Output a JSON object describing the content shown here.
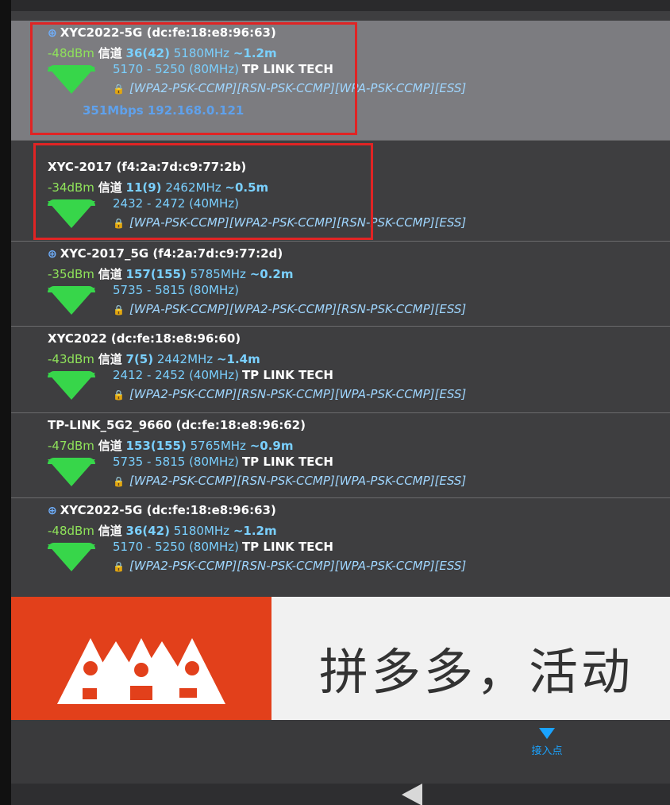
{
  "networks": [
    {
      "globe": "⊕",
      "ssid": "XYC2022-5G (dc:fe:18:e8:96:63)",
      "dbm": "-48dBm",
      "ch_label": "信道",
      "channel": "36(42)",
      "freq": "5180MHz",
      "dist": "~1.2m",
      "range": "5170 - 5250 (80MHz)",
      "vendor": "TP LINK TECH",
      "security": "[WPA2-PSK-CCMP][RSN-PSK-CCMP][WPA-PSK-CCMP][ESS]",
      "conn": "351Mbps 192.168.0.121"
    },
    {
      "ssid": "XYC-2017 (f4:2a:7d:c9:77:2b)",
      "dbm": "-34dBm",
      "ch_label": "信道",
      "channel": "11(9)",
      "freq": "2462MHz",
      "dist": "~0.5m",
      "range": "2432 - 2472 (40MHz)",
      "security": "[WPA-PSK-CCMP][WPA2-PSK-CCMP][RSN-PSK-CCMP][ESS]"
    },
    {
      "globe": "⊕",
      "ssid": "XYC-2017_5G (f4:2a:7d:c9:77:2d)",
      "dbm": "-35dBm",
      "ch_label": "信道",
      "channel": "157(155)",
      "freq": "5785MHz",
      "dist": "~0.2m",
      "range": "5735 - 5815 (80MHz)",
      "security": "[WPA-PSK-CCMP][WPA2-PSK-CCMP][RSN-PSK-CCMP][ESS]"
    },
    {
      "ssid": "XYC2022 (dc:fe:18:e8:96:60)",
      "dbm": "-43dBm",
      "ch_label": "信道",
      "channel": "7(5)",
      "freq": "2442MHz",
      "dist": "~1.4m",
      "range": "2412 - 2452 (40MHz)",
      "vendor": "TP LINK TECH",
      "security": "[WPA2-PSK-CCMP][RSN-PSK-CCMP][WPA-PSK-CCMP][ESS]"
    },
    {
      "ssid": "TP-LINK_5G2_9660 (dc:fe:18:e8:96:62)",
      "dbm": "-47dBm",
      "ch_label": "信道",
      "channel": "153(155)",
      "freq": "5765MHz",
      "dist": "~0.9m",
      "range": "5735 - 5815 (80MHz)",
      "vendor": "TP LINK TECH",
      "security": "[WPA2-PSK-CCMP][RSN-PSK-CCMP][WPA-PSK-CCMP][ESS]"
    },
    {
      "globe": "⊕",
      "ssid": "XYC2022-5G (dc:fe:18:e8:96:63)",
      "dbm": "-48dBm",
      "ch_label": "信道",
      "channel": "36(42)",
      "freq": "5180MHz",
      "dist": "~1.2m",
      "range": "5170 - 5250 (80MHz)",
      "vendor": "TP LINK TECH",
      "security": "[WPA2-PSK-CCMP][RSN-PSK-CCMP][WPA-PSK-CCMP][ESS]"
    }
  ],
  "ad": {
    "text": "拼多多，活动"
  },
  "nav": {
    "ap_label": "接入点"
  },
  "lock_glyph": "🔒",
  "colors": {
    "signal_icon": "#37d64a",
    "highlight_box": "#e02424",
    "ad_brand": "#e2401b",
    "accent": "#1aa3ff"
  }
}
